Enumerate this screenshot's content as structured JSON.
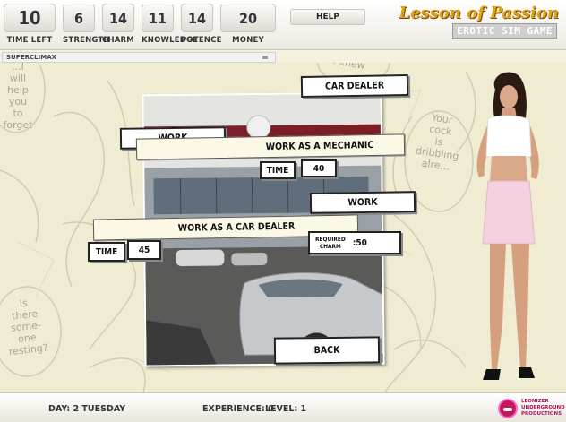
{
  "stats": [
    {
      "key": "time_left",
      "value": "10",
      "label": "TIME LEFT"
    },
    {
      "key": "strength",
      "value": "6",
      "label": "STRENGTH"
    },
    {
      "key": "charm",
      "value": "14",
      "label": "CHARM"
    },
    {
      "key": "knowledge",
      "value": "11",
      "label": "KNOWLEDGE"
    },
    {
      "key": "potence",
      "value": "14",
      "label": "POTENCE"
    },
    {
      "key": "money",
      "value": "20",
      "label": "MONEY"
    }
  ],
  "header": {
    "help_label": "HELP",
    "logo_line1": "Lesson of Passion",
    "logo_line2": "EROTIC SIM GAME"
  },
  "subbar": {
    "title": "SUPERCLIMAX"
  },
  "background_text": {
    "bubble_left": [
      "...I",
      "will",
      "help you",
      "to forget"
    ],
    "bubble_top_right": [
      "I knew"
    ],
    "bubble_right": [
      "Your",
      "cock",
      "is",
      "dribbling",
      "alre..."
    ],
    "bubble_bottom_left": [
      "Is",
      "there",
      "some-",
      "one",
      "resting?"
    ]
  },
  "panel": {
    "title": "CAR DEALER",
    "job1": {
      "button": "WORK",
      "name": "WORK AS A MECHANIC",
      "time_label": "TIME",
      "time_value": "40"
    },
    "job2": {
      "button": "WORK",
      "name": "WORK AS A CAR DEALER",
      "time_label": "TIME",
      "time_value": "45",
      "req_label_line1": "REQUIRED",
      "req_label_line2": "CHARM",
      "req_value": ":50"
    },
    "back_label": "BACK"
  },
  "footer": {
    "day": "DAY: 2 TUESDAY",
    "experience": "EXPERIENCE: 0",
    "level": "LEVEL: 1",
    "publisher_line1": "LEONIZER",
    "publisher_line2": "UNDERGROUND",
    "publisher_line3": "PRODUCTIONS"
  },
  "colors": {
    "logo_gold": "#e0a21a",
    "bg_cream": "#efecd2",
    "publisher_pink": "#b0135c"
  }
}
